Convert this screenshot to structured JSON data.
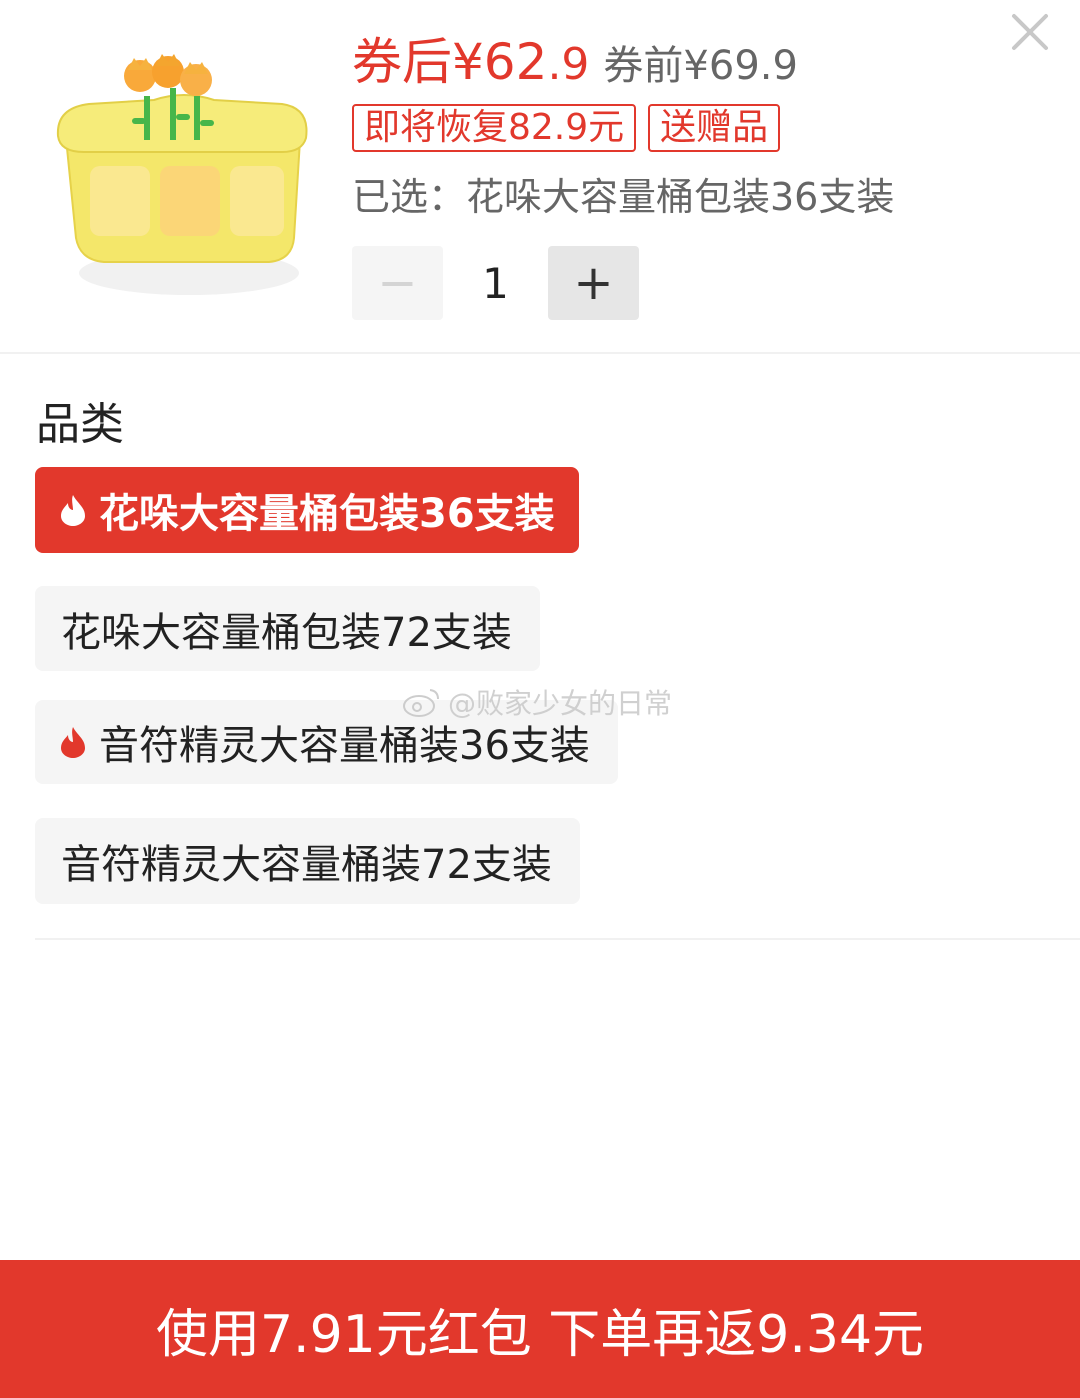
{
  "header": {
    "price_after_label": "券后¥62",
    "price_after_decimal": ".9",
    "price_before": "券前¥69.9",
    "tags": [
      "即将恢复82.9元",
      "送赠品"
    ],
    "selected": "已选：花哚大容量桶包装36支装",
    "quantity": "1",
    "minus_symbol": "−",
    "plus_symbol": "+"
  },
  "category": {
    "title": "品类",
    "options": [
      {
        "label": "花哚大容量桶包装36支装",
        "selected": true,
        "hot": true
      },
      {
        "label": "花哚大容量桶包装72支装",
        "selected": false,
        "hot": false
      },
      {
        "label": "音符精灵大容量桶装36支装",
        "selected": false,
        "hot": true
      },
      {
        "label": "音符精灵大容量桶装72支装",
        "selected": false,
        "hot": false
      }
    ]
  },
  "watermark": "@败家少女的日常",
  "cta": {
    "label": "使用7.91元红包 下单再返9.34元"
  },
  "colors": {
    "accent": "#e2382c",
    "muted_bg": "#f5f5f5"
  },
  "icons": [
    "close-icon",
    "flame-icon",
    "weibo-icon"
  ]
}
